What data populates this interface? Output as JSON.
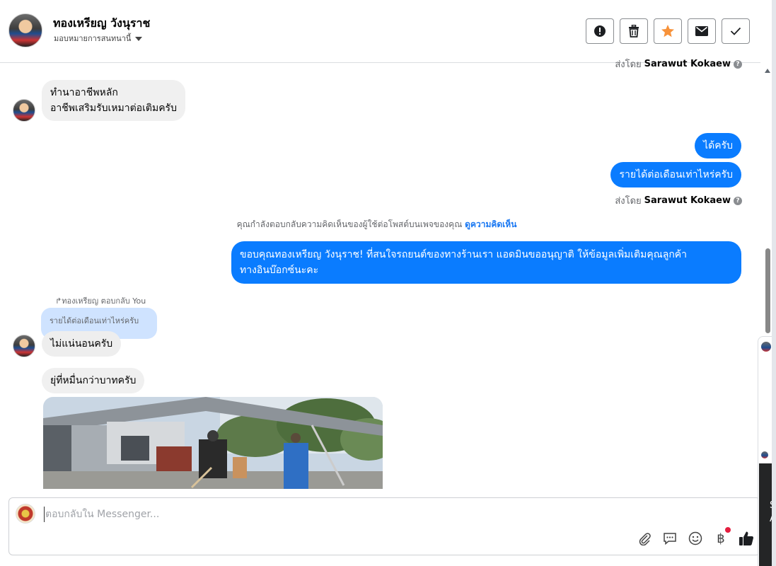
{
  "header": {
    "name": "ทองเหรียญ วังนุราช",
    "assign_label": "มอบหมายการสนทนานี้",
    "actions": [
      {
        "icon": "alert-icon",
        "label": "report"
      },
      {
        "icon": "trash-icon",
        "label": "delete"
      },
      {
        "icon": "star-icon",
        "label": "star"
      },
      {
        "icon": "mail-icon",
        "label": "mark-unread"
      },
      {
        "icon": "check-icon",
        "label": "done"
      }
    ]
  },
  "messages": {
    "top_sent_by_prefix": "ส่งโดย",
    "top_sent_by_name": "Sarawut Kokaew",
    "incoming_1": "ทำนาอาชีพหลัก\nอาชีพเสริมรับเหมาต่อเติมครับ",
    "outgoing_1": "ได้ครับ",
    "outgoing_2": "รายได้ต่อเดือนเท่าไหร่ครับ",
    "sent_by_prefix": "ส่งโดย",
    "sent_by_name": "Sarawut Kokaew",
    "notice_text": "คุณกำลังตอบกลับความคิดเห็นของผู้ใช้ต่อโพสต์บนเพจของคุณ",
    "notice_link": "ดูความคิดเห็น",
    "outgoing_3": "ขอบคุณทองเหรียญ วังนุราช! ที่สนใจรถยนต์ของทางร้านเรา แอดมินขออนุญาติ ให้ข้อมูลเพิ่มเติมคุณลูกค้า\nทางอินบ๊อกซ์นะคะ",
    "reply_label": "↱ทองเหรียญ ตอบกลับ You",
    "reply_quote": "รายได้ต่อเดือนเท่าไหร่ครับ",
    "incoming_2": "ไม่แน่นอนครับ",
    "incoming_3": "ยุ่ที่หมื่นกว่าบาทครับ"
  },
  "composer": {
    "placeholder": "ตอบกลับใน Messenger...",
    "tools": [
      "paperclip-icon",
      "saved-reply-icon",
      "emoji-icon",
      "baht-icon",
      "thumbs-up-icon"
    ]
  },
  "side_panel": {
    "text_1": "S",
    "text_2": "A"
  },
  "colors": {
    "accent": "#0a7cff",
    "incoming_bubble": "#f0f0f0",
    "star": "#f7923a"
  }
}
